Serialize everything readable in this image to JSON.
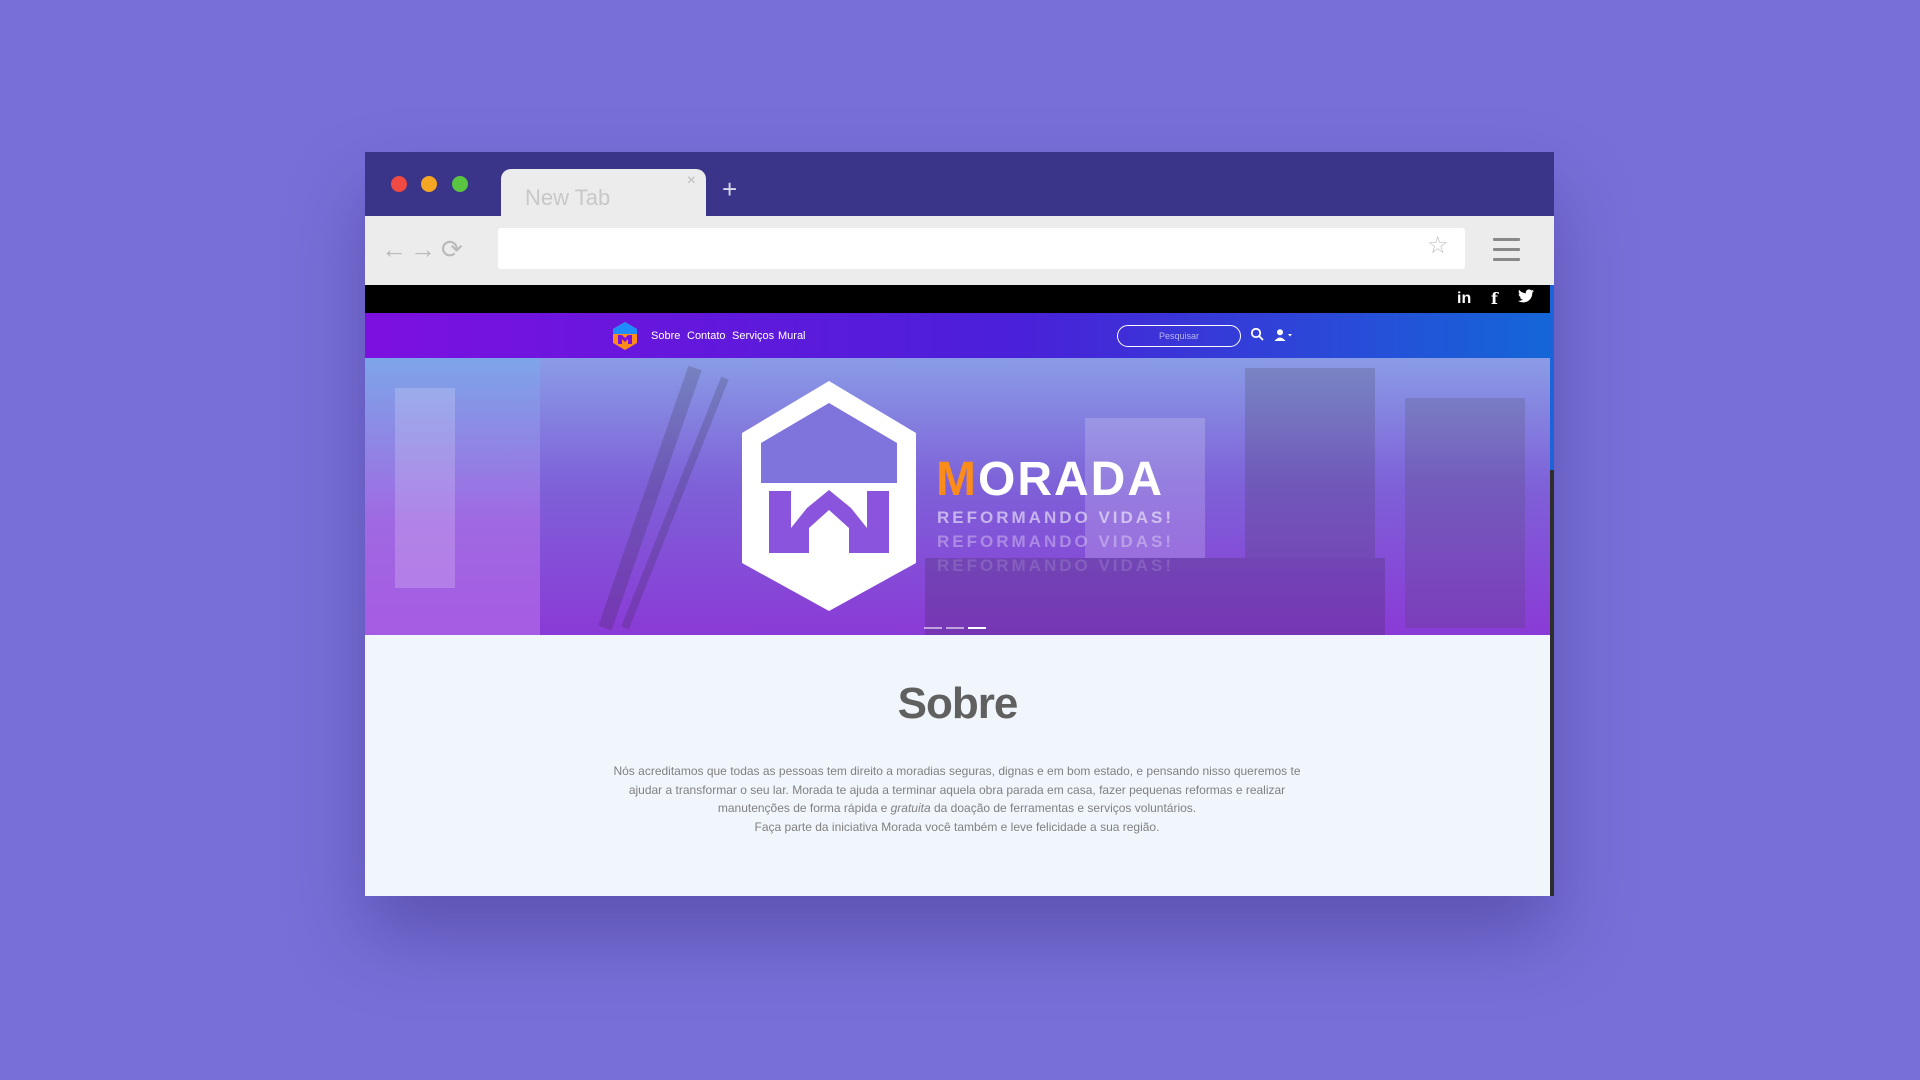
{
  "browser": {
    "tab_title": "New Tab",
    "tab_close": "×",
    "new_tab": "+",
    "url": ""
  },
  "icons": {
    "back": "arrow-left-icon",
    "forward": "arrow-right-icon",
    "reload": "reload-icon",
    "bookmark": "star-icon",
    "menu": "hamburger-menu-icon",
    "search": "search-icon",
    "user": "user-icon"
  },
  "social": {
    "linkedin": "in",
    "facebook": "f",
    "twitter": "twitter-icon"
  },
  "navbar": {
    "links": [
      "Sobre",
      "Contato",
      "Serviços",
      "Mural"
    ],
    "search_placeholder": "Pesquisar"
  },
  "hero": {
    "brand_first": "M",
    "brand_rest": "ORADA",
    "tagline": "REFORMANDO VIDAS!",
    "carousel_slides": 3,
    "active_slide": 3
  },
  "about": {
    "title": "Sobre",
    "line1": "Nós acreditamos que todas as pessoas tem direito a moradias seguras, dignas e em bom estado, e pensando nisso queremos te",
    "line2": "ajudar a transformar o seu lar. Morada te ajuda a terminar aquela obra parada em casa, fazer pequenas reformas e realizar",
    "line3_a": "manutenções de forma rápida e ",
    "line3_em": "gratuita",
    "line3_b": " da doação de ferramentas e serviços voluntários.",
    "line4": "Faça parte da iniciativa Morada você também e leve felicidade a sua região."
  },
  "colors": {
    "page_background": "#7870d8",
    "titlebar": "#3b358a",
    "brand_orange": "#fb8c1a",
    "nav_gradient_start": "#7d10e0",
    "nav_gradient_end": "#1466d8"
  }
}
